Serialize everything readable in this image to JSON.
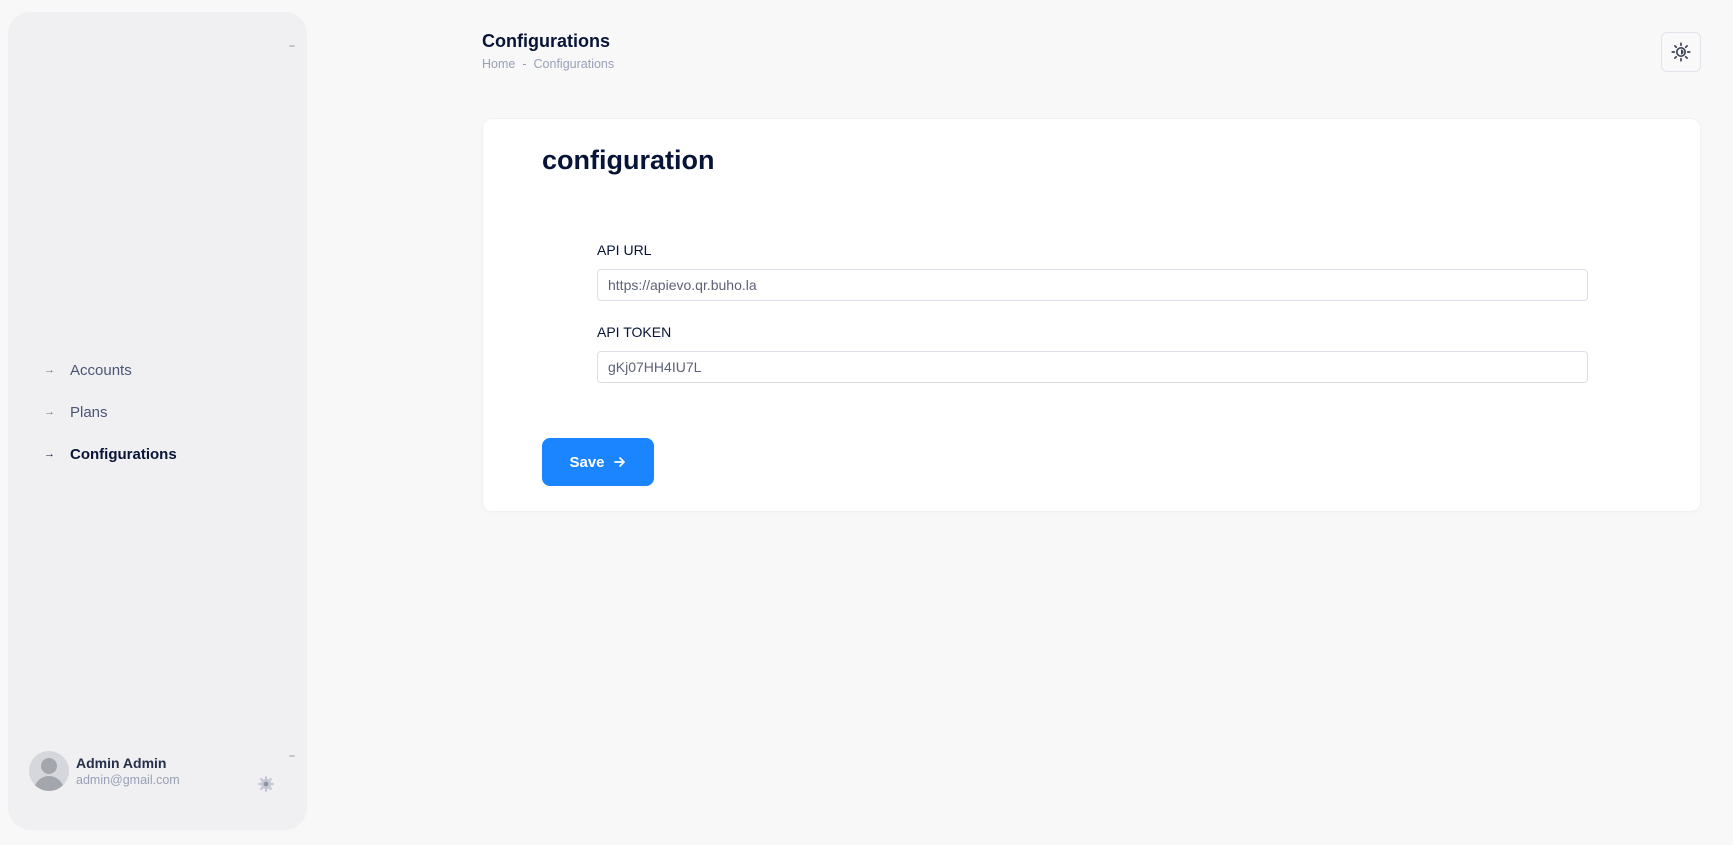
{
  "header": {
    "title": "Configurations",
    "breadcrumb": [
      "Home",
      "Configurations"
    ],
    "breadcrumb_separator": "-",
    "theme_icon": "sun-icon"
  },
  "sidebar": {
    "items": [
      {
        "label": "Accounts",
        "icon": "arrow-right-icon",
        "active": false
      },
      {
        "label": "Plans",
        "icon": "arrow-right-icon",
        "active": false
      },
      {
        "label": "Configurations",
        "icon": "arrow-right-icon",
        "active": true
      }
    ],
    "user": {
      "name": "Admin Admin",
      "email": "admin@gmail.com",
      "settings_icon": "gear-icon"
    }
  },
  "main": {
    "card_title": "configuration",
    "fields": [
      {
        "label": "API URL",
        "value": "https://apievo.qr.buho.la"
      },
      {
        "label": "API TOKEN",
        "value": "gKj07HH4IU7L"
      }
    ],
    "save_label": "Save",
    "save_icon": "arrow-right-icon"
  },
  "colors": {
    "accent": "#1b84ff",
    "sidebar_bg": "#f0f0f3",
    "page_bg": "#f8f8f9",
    "text_dark": "#071437",
    "text_muted": "#99a1b7"
  }
}
